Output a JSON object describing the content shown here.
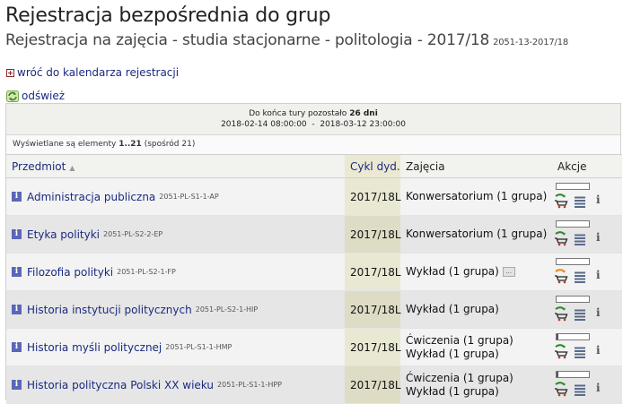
{
  "page": {
    "title": "Rejestracja bezpośrednia do grup",
    "subtitle": "Rejestracja na zajęcia - studia stacjonarne - politologia - 2017/18",
    "subtitle_code": "2051-13-2017/18"
  },
  "links": {
    "back": "wróć do kalendarza rejestracji",
    "refresh": "odśwież"
  },
  "info": {
    "remaining_prefix": "Do końca tury pozostało",
    "remaining_value": "26 dni",
    "date_range": "2018-02-14 08:00:00  -  2018-03-12 23:00:00"
  },
  "count": {
    "prefix": "Wyświetlane są elementy",
    "range": "1..21",
    "suffix": "(spośród 21)"
  },
  "table": {
    "headers": {
      "subject": "Przedmiot",
      "cycle": "Cykl dyd.",
      "classes": "Zajęcia",
      "actions": "Akcje"
    },
    "rows": [
      {
        "name": "Administracja publiczna",
        "code": "2051-PL-S1-1-AP",
        "cycle": "2017/18L",
        "classes": [
          "Konwersatorium (1 grupa)"
        ],
        "more": false,
        "cart": "green",
        "fill": 0.0
      },
      {
        "name": "Etyka polityki",
        "code": "2051-PL-S2-2-EP",
        "cycle": "2017/18L",
        "classes": [
          "Konwersatorium (1 grupa)"
        ],
        "more": false,
        "cart": "green",
        "fill": 0.0
      },
      {
        "name": "Filozofia polityki",
        "code": "2051-PL-S2-1-FP",
        "cycle": "2017/18L",
        "classes": [
          "Wykład (1 grupa)"
        ],
        "more": true,
        "cart": "orange",
        "fill": 0.0
      },
      {
        "name": "Historia instytucji politycznych",
        "code": "2051-PL-S2-1-HIP",
        "cycle": "2017/18L",
        "classes": [
          "Wykład (1 grupa)"
        ],
        "more": false,
        "cart": "green",
        "fill": 0.0
      },
      {
        "name": "Historia myśli politycznej",
        "code": "2051-PL-S1-1-HMP",
        "cycle": "2017/18L",
        "classes": [
          "Ćwiczenia (1 grupa)",
          "Wykład (1 grupa)"
        ],
        "more": false,
        "cart": "green",
        "fill": 0.05
      },
      {
        "name": "Historia polityczna Polski XX wieku",
        "code": "2051-PL-S1-1-HPP",
        "cycle": "2017/18L",
        "classes": [
          "Ćwiczenia (1 grupa)",
          "Wykład (1 grupa)"
        ],
        "more": false,
        "cart": "green",
        "fill": 0.05
      }
    ]
  },
  "colors": {
    "link": "#1a2a80",
    "info_icon": "#5a66b8",
    "cart_green": "#2e8b2e",
    "cart_orange": "#e08a1a"
  }
}
